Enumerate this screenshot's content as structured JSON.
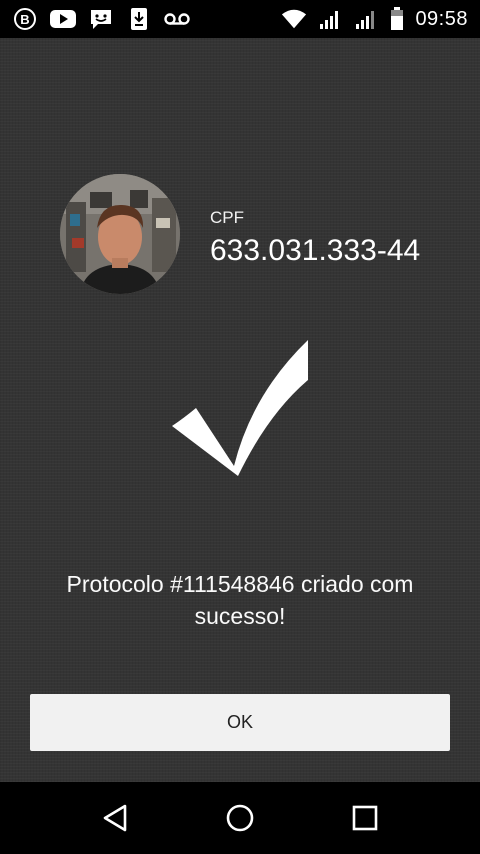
{
  "status_bar": {
    "time": "09:58",
    "left_icons": [
      "bbm-icon",
      "youtube-icon",
      "chat-icon",
      "download-icon",
      "voicemail-icon"
    ],
    "right_icons": [
      "wifi-icon",
      "signal-icon",
      "signal-icon-2",
      "battery-icon"
    ]
  },
  "profile": {
    "cpf_label": "CPF",
    "cpf_value": "633.031.333-44"
  },
  "result": {
    "message": "Protocolo #111548846 criado com sucesso!",
    "icon": "checkmark-icon"
  },
  "actions": {
    "ok_label": "OK"
  },
  "nav_bar": {
    "buttons": [
      "back-icon",
      "home-icon",
      "recents-icon"
    ]
  },
  "colors": {
    "background": "#343434",
    "button_bg": "#f1f1f1",
    "text": "#ffffff"
  }
}
